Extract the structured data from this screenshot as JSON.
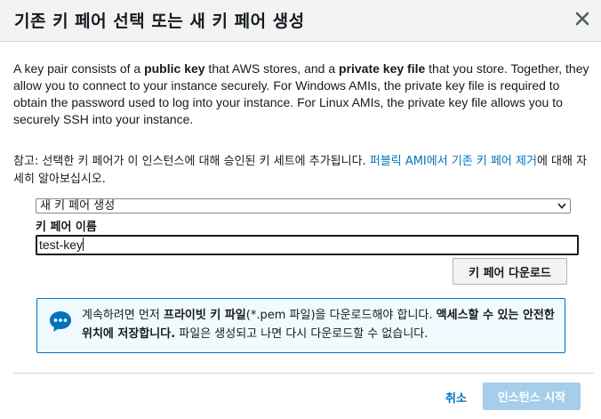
{
  "dialog": {
    "title": "기존 키 페어 선택 또는 새 키 페어 생성",
    "close_icon": "close-icon"
  },
  "description": {
    "p1": "A key pair consists of a ",
    "b1": "public key",
    "p2": " that AWS stores, and a ",
    "b2": "private key file",
    "p3": " that you store. Together, they allow you to connect to your instance securely. For Windows AMIs, the private key file is required to obtain the password used to log into your instance. For Linux AMIs, the private key file allows you to securely SSH into your instance."
  },
  "note": {
    "text": "참고: 선택한 키 페어가 이 인스턴스에 대해 승인된 키 세트에 추가됩니다. ",
    "link": "퍼블릭 AMI에서 기존 키 페어 제거",
    "suffix": "에 대해 자세히 알아보십시오."
  },
  "form": {
    "select_value": "새 키 페어 생성",
    "field_label": "키 페어 이름",
    "input_value": "test-key",
    "download_label": "키 페어 다운로드"
  },
  "info": {
    "icon": "chat-bubble-icon",
    "t1": "계속하려면 먼저 ",
    "b1": "프라이빗 키 파일",
    "t2": "(*.pem 파일)을 다운로드해야 합니다. ",
    "b2": "액세스할 수 있는 안전한 위치에 저장합니다.",
    "t3": " 파일은 생성되고 나면 다시 다운로드할 수 없습니다."
  },
  "footer": {
    "cancel_label": "취소",
    "launch_label": "인스턴스 시작"
  },
  "colors": {
    "link": "#0073bb",
    "launch_disabled": "#a6cde9",
    "info_border": "#0073bb",
    "info_bg": "#f1faff"
  }
}
